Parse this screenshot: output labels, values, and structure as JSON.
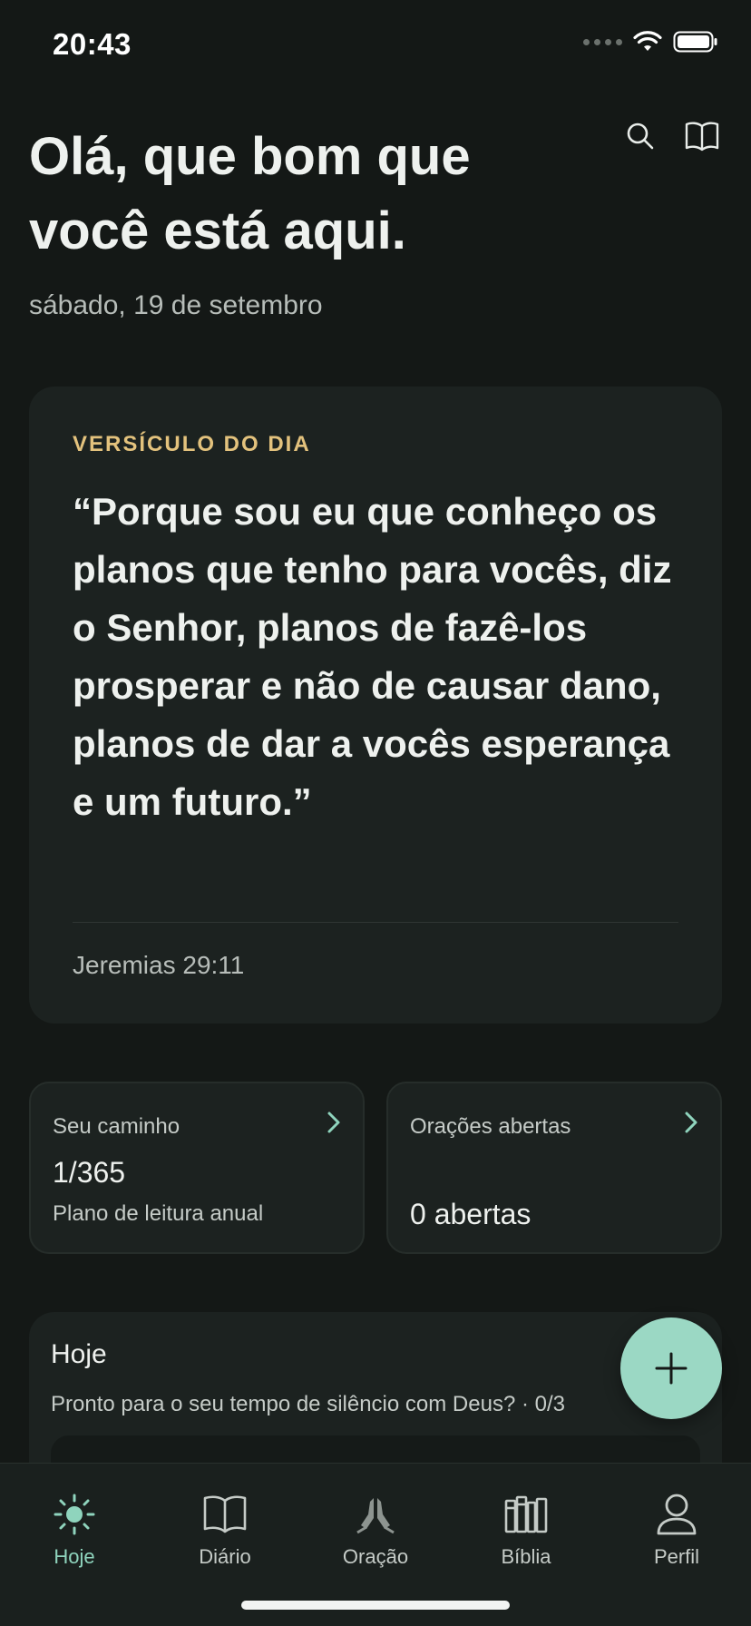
{
  "status_bar": {
    "time": "20:43"
  },
  "header": {
    "greeting": "Olá, que bom que você está aqui.",
    "date": "sábado, 19 de setembro",
    "icons": [
      "search-icon",
      "book-open-icon"
    ]
  },
  "verse": {
    "label": "VERSÍCULO DO DIA",
    "text": "“Porque sou eu que conheço os planos que tenho para vocês, diz o Senhor, planos de fazê-los prosperar e não de causar dano, planos de dar a vocês esperança e um futuro.”",
    "reference": "Jeremias 29:11"
  },
  "cards": {
    "path": {
      "title": "Seu caminho",
      "value": "1/365",
      "subtitle": "Plano de leitura anual"
    },
    "prayers": {
      "title": "Orações abertas",
      "value": "0 abertas"
    }
  },
  "today": {
    "title": "Hoje",
    "subtitle": "Pronto para o seu tempo de silêncio com Deus? · 0/3"
  },
  "fab": {
    "icon": "plus-icon"
  },
  "tabs": [
    {
      "label": "Hoje",
      "icon": "sun-icon",
      "active": true
    },
    {
      "label": "Diário",
      "icon": "book-icon",
      "active": false
    },
    {
      "label": "Oração",
      "icon": "praying-hands-icon",
      "active": false
    },
    {
      "label": "Bíblia",
      "icon": "books-icon",
      "active": false
    },
    {
      "label": "Perfil",
      "icon": "person-icon",
      "active": false
    }
  ],
  "colors": {
    "background": "#141816",
    "card": "#1c2220",
    "accent": "#8fd4bd",
    "label_gold": "#e3c27d"
  }
}
